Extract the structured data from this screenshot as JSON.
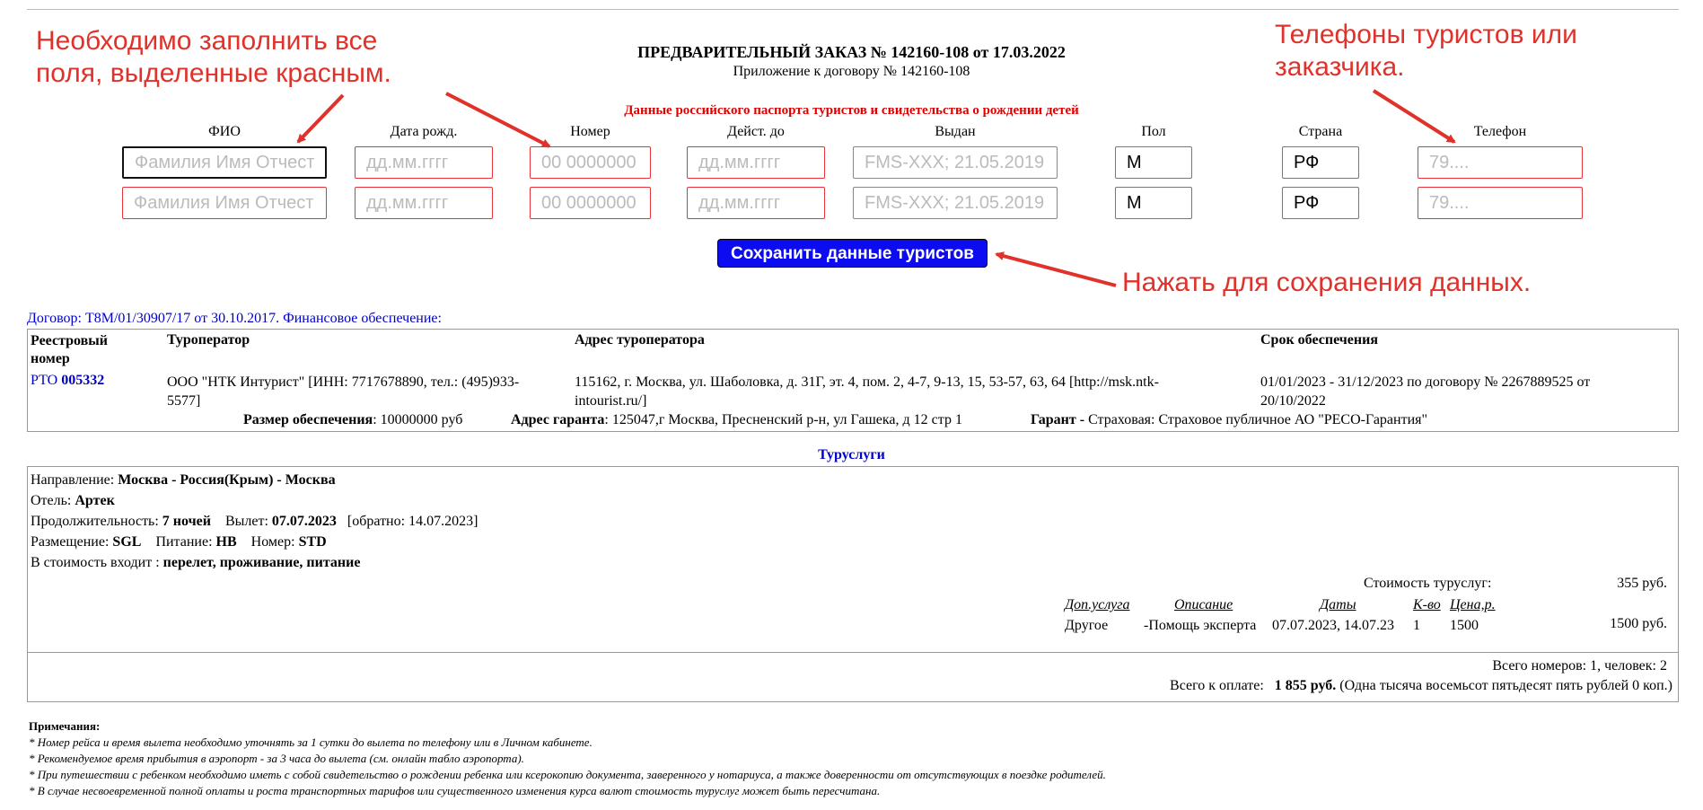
{
  "header": {
    "title": "ПРЕДВАРИТЕЛЬНЫЙ ЗАКАЗ № 142160-108 от 17.03.2022",
    "subtitle": "Приложение к договору № 142160-108",
    "passport_heading": "Данные российского паспорта туристов и свидетельства о рождении детей"
  },
  "annotations": {
    "fill_red_line1": "Необходимо заполнить все",
    "fill_red_line2": "поля, выделенные красным.",
    "phones_line1": "Телефоны туристов или",
    "phones_line2": "заказчика.",
    "save_hint": "Нажать для сохранения данных.",
    "color": "#e0322a"
  },
  "tourist_form": {
    "columns": [
      "ФИО",
      "Дата рожд.",
      "Номер",
      "Дейст. до",
      "Выдан",
      "Пол",
      "Страна",
      "Телефон"
    ],
    "rows": [
      {
        "fio_placeholder": "Фамилия Имя Отчест",
        "birth_placeholder": "дд.мм.гггг",
        "number_placeholder": "00 0000000",
        "valid_placeholder": "дд.мм.гггг",
        "issued_placeholder": "FMS-XXX; 21.05.2019",
        "sex": "М",
        "country": "РФ",
        "phone_placeholder": "79...."
      },
      {
        "fio_placeholder": "Фамилия Имя Отчест",
        "birth_placeholder": "дд.мм.гггг",
        "number_placeholder": "00 0000000",
        "valid_placeholder": "дд.мм.гггг",
        "issued_placeholder": "FMS-XXX; 21.05.2019",
        "sex": "М",
        "country": "РФ",
        "phone_placeholder": "79...."
      }
    ],
    "save_button": "Сохранить данные туристов",
    "required_color": "#e5333a",
    "button_color": "#0d0bf0"
  },
  "contract": {
    "line": "Договор: T8M/01/30907/17 от 30.10.2017. Финансовое обеспечение:",
    "headers": {
      "reg_number_1": "Реестровый",
      "reg_number_2": "номер",
      "operator": "Туроператор",
      "operator_address": "Адрес туроператора",
      "term": "Срок обеспечения"
    },
    "reg_prefix": "РТО ",
    "reg_number": "005332",
    "operator_line1": "ООО \"НТК Интурист\" [ИНН: 7717678890, тел.: (495)933-",
    "operator_line2": "5577]",
    "address_line1": "115162, г. Москва, ул. Шаболовка, д. 31Г, эт. 4, пом. 2, 4-7, 9-13, 15, 53-57, 63, 64 [http://msk.ntk-",
    "address_line2": "intourist.ru/]",
    "term_line1": "01/01/2023 - 31/12/2023 по договору № 2267889525 от",
    "term_line2": "20/10/2022",
    "amount_label": "Размер обеспечения",
    "amount_value": ": 10000000 руб",
    "guarantor_addr_label": "Адрес гаранта",
    "guarantor_addr_value": ": 125047,г Москва, Пресненский р-н, ул Гашека, д 12 стр 1",
    "guarantor_label": "Гарант -",
    "guarantor_value": " Страховая: Страховое публичное АО \"РЕСО-Гарантия\""
  },
  "services": {
    "heading": "Туруслуги",
    "direction_label": "Направление: ",
    "direction_value": "Москва - Россия(Крым) - Москва",
    "hotel_label": "Отель: ",
    "hotel_value": "Артек",
    "duration_label": "Продолжительность: ",
    "duration_value": "7 ночей",
    "depart_label": "Вылет: ",
    "depart_value": "07.07.2023",
    "return_text": "[обратно: 14.07.2023]",
    "placement_label": "Размещение: ",
    "placement_value": "SGL",
    "meal_label": "Питание: ",
    "meal_value": "HB",
    "room_label": "Номер: ",
    "room_value": "STD",
    "included_label": "В стоимость входит : ",
    "included_value": "перелет, проживание, питание",
    "cost_label": "Стоимость туруслуг:",
    "cost_value": "355 руб.",
    "extra_headers": [
      "Доп.услуга",
      "Описание",
      "Даты",
      "К-во",
      "Цена,р."
    ],
    "extra_row": {
      "service": "Другое",
      "description": "-Помощь эксперта",
      "dates": "07.07.2023, 14.07.23",
      "qty": "1",
      "price": "1500",
      "total": "1500 руб."
    }
  },
  "totals": {
    "rooms_people": "Всего номеров: 1, человек: 2",
    "pay_label": "Всего к оплате:",
    "pay_value": "1 855 руб.",
    "pay_words": "(Одна тысяча восемьсот пятьдесят пять рублей 0 коп.)"
  },
  "notes": {
    "title": "Примечания:",
    "items": [
      "* Номер рейса и время вылета необходимо уточнять за 1 сутки до вылета по телефону или в Личном кабинете.",
      "* Рекомендуемое время прибытия в аэропорт - за 3 часа до вылета (см. онлайн табло аэропорта).",
      "* При путешествии с ребенком необходимо иметь с собой свидетельство о рождении ребенка или ксерокопию документа, заверенного у нотариуса, а также доверенности от отсутствующих в поездке родителей.",
      "* В случае несвоевременной полной оплаты и роста транспортных тарифов или существенного изменения курса валют стоимость туруслуг может быть пересчитана."
    ]
  }
}
